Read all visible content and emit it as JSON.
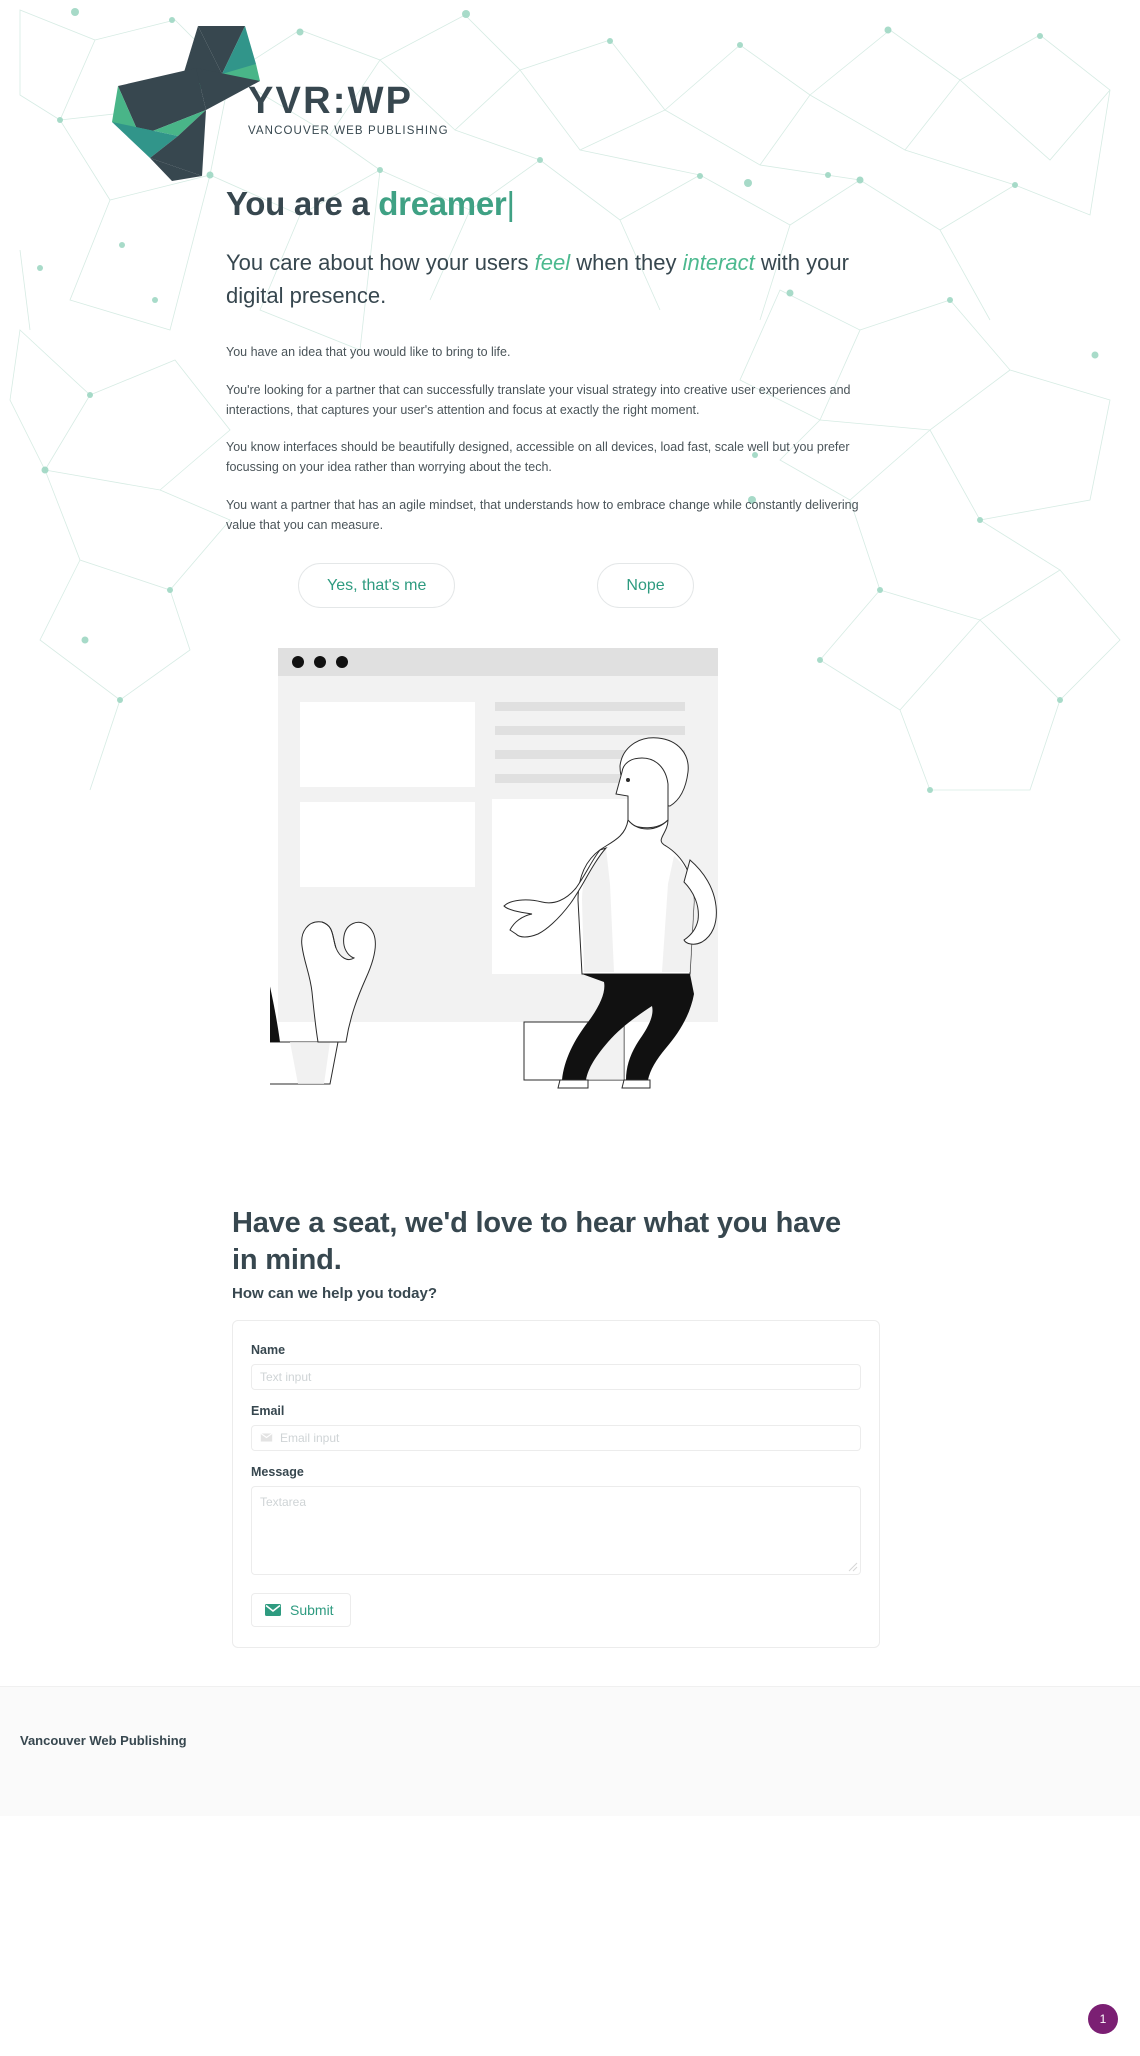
{
  "brand": {
    "logo_title": "YVR:WP",
    "logo_subtitle": "VANCOUVER WEB PUBLISHING",
    "accent_color": "#3fa184",
    "dark_color": "#37474f",
    "light_accent_color": "#4cb98f"
  },
  "hero": {
    "headline_prefix": "You are a ",
    "headline_accent": "dreamer",
    "headline_caret": "|",
    "subhead_part1": "You care about how your users ",
    "subhead_em1": "feel",
    "subhead_part2": " when they ",
    "subhead_em2": "interact",
    "subhead_part3": " with your digital presence.",
    "paragraphs": [
      "You have an idea that you would like to bring to life.",
      "You're looking for a partner that can successfully translate your visual strategy into creative user experiences and interactions, that captures your user's attention and focus at exactly the right moment.",
      "You know interfaces should be beautifully designed, accessible on all devices, load fast, scale well but you prefer focussing on your idea rather than worrying about the tech.",
      "You want a partner that has an agile mindset, that understands how to embrace change while constantly delivering value that you can measure."
    ],
    "cta_yes": "Yes, that's me",
    "cta_no": "Nope"
  },
  "illustration": {
    "alt": "person presenting a browser window mockup with a potted cactus"
  },
  "contact": {
    "title": "Have a seat, we'd love to hear what you have in mind.",
    "subtitle": "How can we help you today?",
    "fields": {
      "name_label": "Name",
      "name_placeholder": "Text input",
      "name_value": "",
      "email_label": "Email",
      "email_placeholder": "Email input",
      "email_value": "",
      "message_label": "Message",
      "message_placeholder": "Textarea",
      "message_value": ""
    },
    "submit_label": "Submit"
  },
  "footer": {
    "brand": "Vancouver Web Publishing"
  },
  "badge": {
    "count": "1",
    "color": "#7b1f73"
  }
}
